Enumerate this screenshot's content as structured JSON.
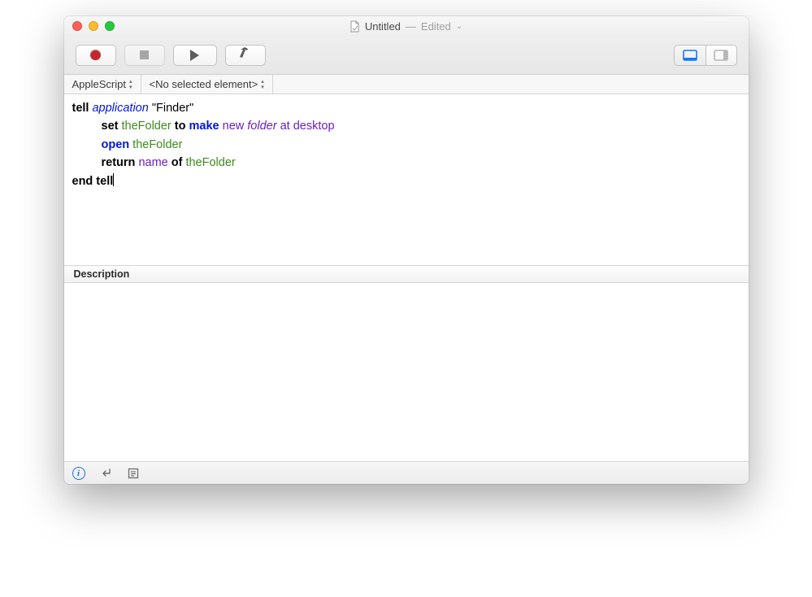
{
  "window": {
    "title": "Untitled",
    "separator": "—",
    "state": "Edited"
  },
  "toolbar": {
    "record": "record",
    "stop": "stop",
    "run": "run",
    "build": "build",
    "view_editor": "editor-view",
    "view_split": "split-view"
  },
  "navbar": {
    "language": "AppleScript",
    "element": "<No selected element>"
  },
  "code": {
    "l1": {
      "tell": "tell",
      "application": "application",
      "finder": "\"Finder\""
    },
    "l2": {
      "set": "set",
      "var": "theFolder",
      "to": "to",
      "make": "make",
      "new": "new",
      "folder": "folder",
      "at": "at",
      "desktop": "desktop"
    },
    "l3": {
      "open": "open",
      "var": "theFolder"
    },
    "l4": {
      "return": "return",
      "name": "name",
      "of": "of",
      "var": "theFolder"
    },
    "l5": {
      "end_tell": "end tell"
    }
  },
  "description": {
    "header": "Description"
  },
  "status": {
    "info": "i"
  }
}
